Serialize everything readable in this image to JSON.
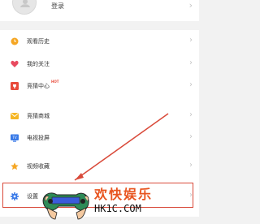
{
  "header": {
    "login_label": "登录"
  },
  "menu": {
    "items": [
      {
        "label": "观看历史",
        "icon": "clock-icon",
        "color": "#f5a623"
      },
      {
        "label": "我的关注",
        "icon": "heart-icon",
        "color": "#e84a5f"
      },
      {
        "label": "竞猜中心",
        "badge": "HOT",
        "icon": "trophy-icon",
        "color": "#e84a3a"
      },
      {
        "label": "竞猜商城",
        "icon": "mail-icon",
        "color": "#f5b623"
      },
      {
        "label": "电视投屏",
        "icon": "tv-icon",
        "color": "#3a7be8"
      },
      {
        "label": "视频收藏",
        "icon": "star-icon",
        "color": "#f5a623"
      },
      {
        "label": "设置",
        "icon": "gear-icon",
        "color": "#3a7be8"
      }
    ]
  },
  "watermark": {
    "title": "欢快娱乐",
    "domain": "HK1C.COM"
  },
  "colors": {
    "highlight": "#d94a3a",
    "accent": "#e8541f"
  }
}
